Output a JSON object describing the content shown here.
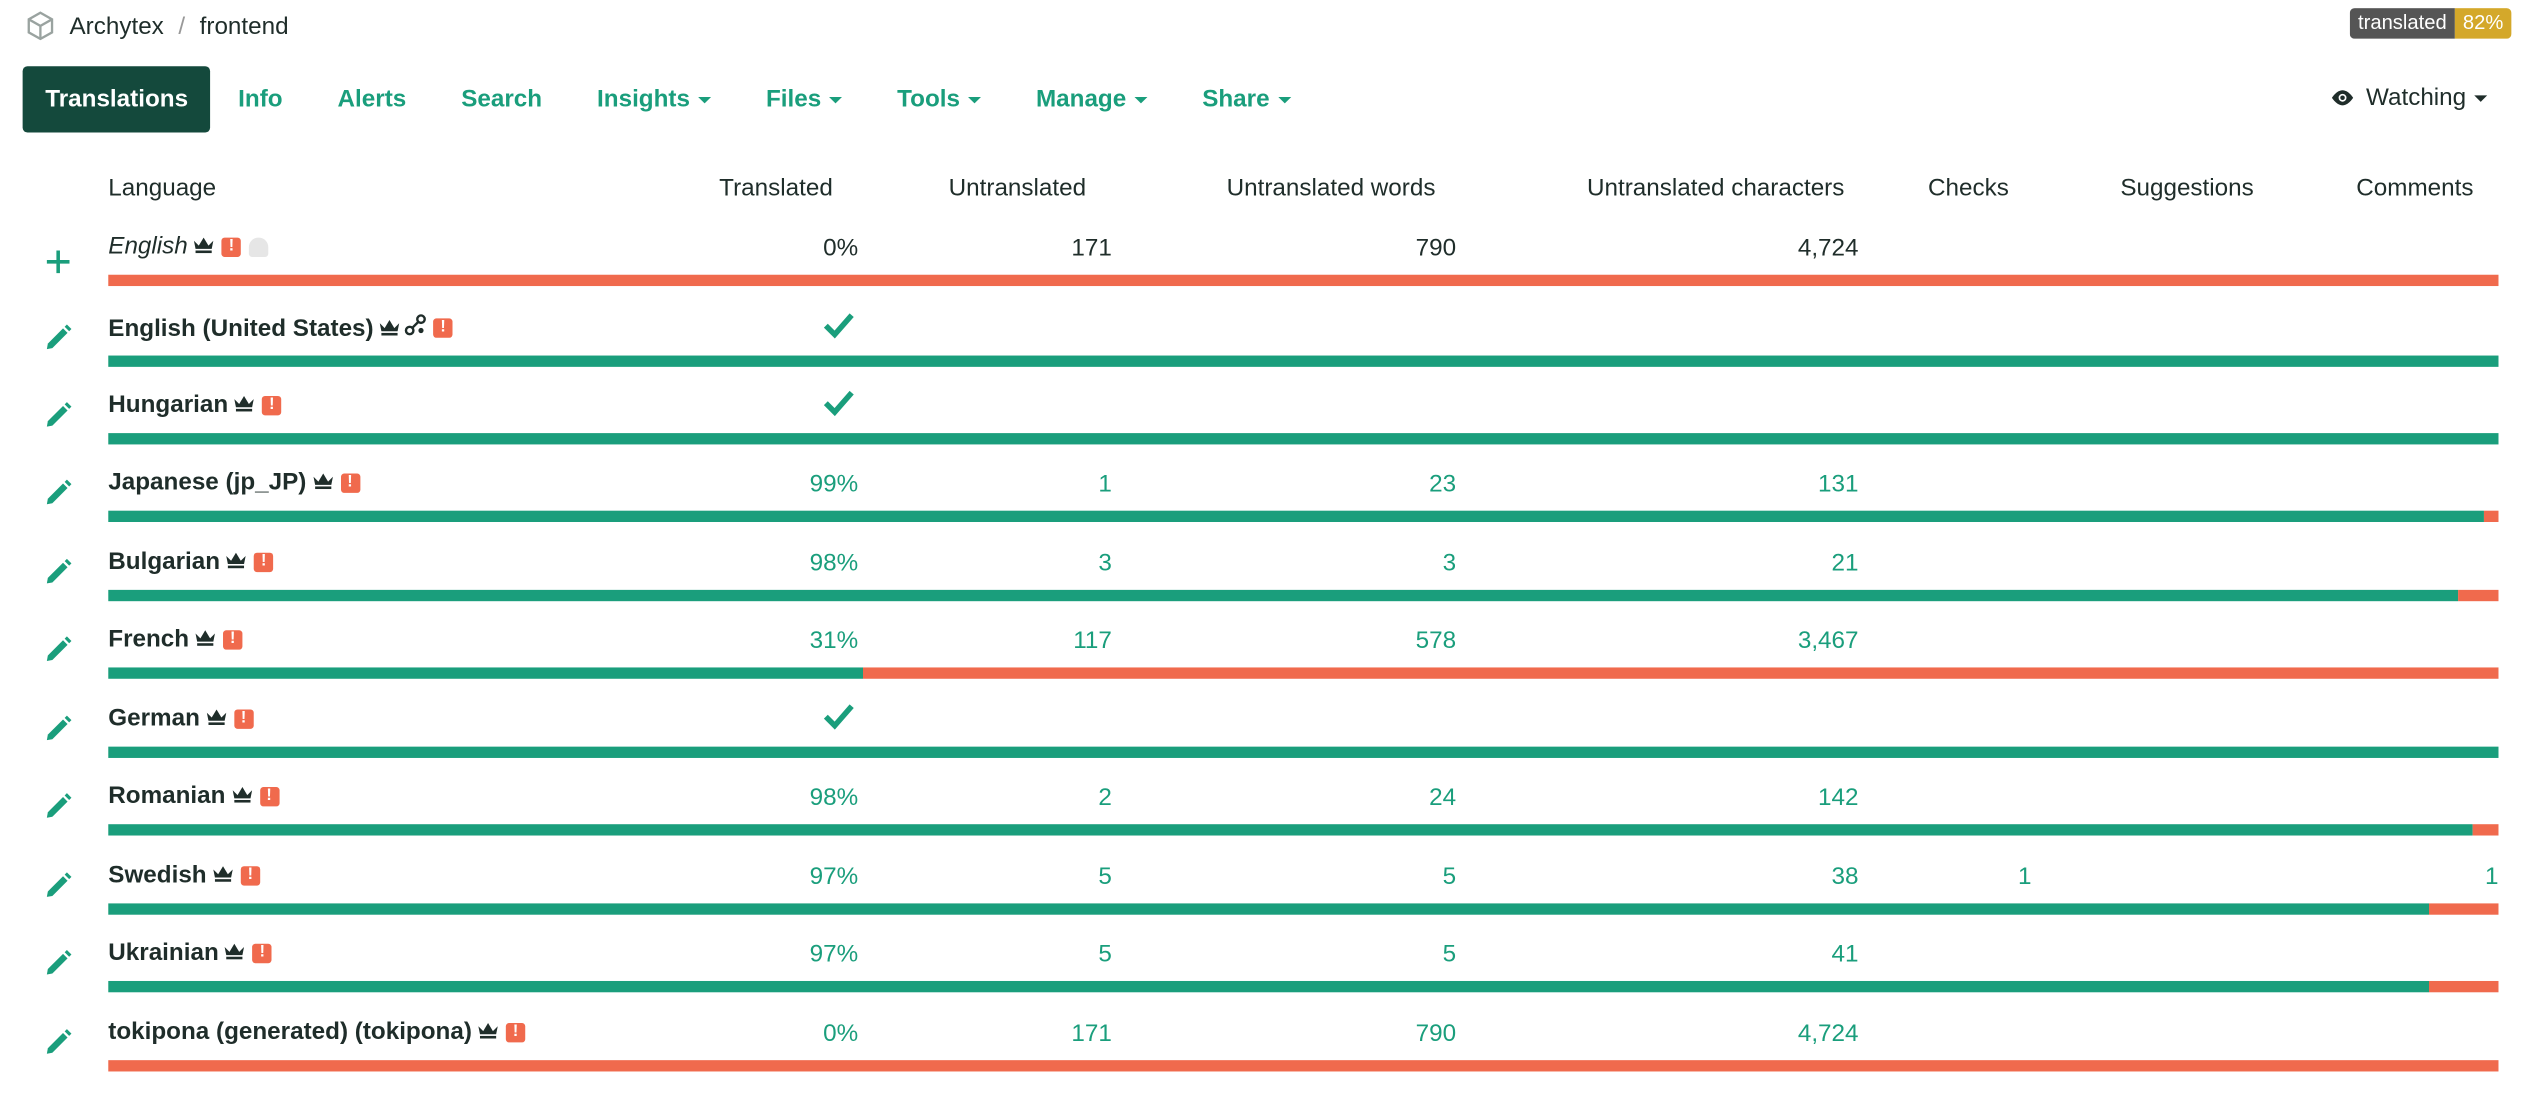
{
  "breadcrumb": {
    "project": "Archytex",
    "component": "frontend"
  },
  "badge": {
    "label": "translated",
    "value": "82%"
  },
  "nav": {
    "translations": "Translations",
    "info": "Info",
    "alerts": "Alerts",
    "search": "Search",
    "insights": "Insights",
    "files": "Files",
    "tools": "Tools",
    "manage": "Manage",
    "share": "Share",
    "watching": "Watching"
  },
  "headers": {
    "language": "Language",
    "translated": "Translated",
    "untranslated": "Untranslated",
    "untranslated_words": "Untranslated words",
    "untranslated_chars": "Untranslated characters",
    "checks": "Checks",
    "suggestions": "Suggestions",
    "comments": "Comments"
  },
  "rows": [
    {
      "name": "English",
      "source": true,
      "translated": "0%",
      "untranslated": "171",
      "words": "790",
      "chars": "4,724",
      "checks": "",
      "comments": "",
      "fill": 0.0,
      "complete": false
    },
    {
      "name": "English (United States)",
      "link": true,
      "translated": "",
      "untranslated": "",
      "words": "",
      "chars": "",
      "checks": "",
      "comments": "",
      "fill": 1.0,
      "complete": true
    },
    {
      "name": "Hungarian",
      "translated": "",
      "untranslated": "",
      "words": "",
      "chars": "",
      "checks": "",
      "comments": "",
      "fill": 1.0,
      "complete": true
    },
    {
      "name": "Japanese (jp_JP)",
      "translated": "99%",
      "untranslated": "1",
      "words": "23",
      "chars": "131",
      "checks": "",
      "comments": "",
      "fill": 0.994,
      "complete": false
    },
    {
      "name": "Bulgarian",
      "translated": "98%",
      "untranslated": "3",
      "words": "3",
      "chars": "21",
      "checks": "",
      "comments": "",
      "fill": 0.983,
      "complete": false
    },
    {
      "name": "French",
      "translated": "31%",
      "untranslated": "117",
      "words": "578",
      "chars": "3,467",
      "checks": "",
      "comments": "",
      "fill": 0.316,
      "complete": false
    },
    {
      "name": "German",
      "translated": "",
      "untranslated": "",
      "words": "",
      "chars": "",
      "checks": "",
      "comments": "",
      "fill": 1.0,
      "complete": true
    },
    {
      "name": "Romanian",
      "translated": "98%",
      "untranslated": "2",
      "words": "24",
      "chars": "142",
      "checks": "",
      "comments": "",
      "fill": 0.989,
      "complete": false
    },
    {
      "name": "Swedish",
      "translated": "97%",
      "untranslated": "5",
      "words": "5",
      "chars": "38",
      "checks": "1",
      "comments": "1",
      "fill": 0.971,
      "complete": false
    },
    {
      "name": "Ukrainian",
      "translated": "97%",
      "untranslated": "5",
      "words": "5",
      "chars": "41",
      "checks": "",
      "comments": "",
      "fill": 0.971,
      "complete": false
    },
    {
      "name": "tokipona (generated) (tokipona)",
      "translated": "0%",
      "untranslated": "171",
      "words": "790",
      "chars": "4,724",
      "checks": "",
      "comments": "",
      "fill": 0.0,
      "complete": false
    }
  ],
  "colors": {
    "accent": "#1a9e7c",
    "danger": "#f06a4d",
    "nav_active": "#14493c",
    "badge": "#d4a82a"
  },
  "icons": {
    "add": "plus-icon",
    "edit": "pencil-icon",
    "done": "check-icon",
    "watch": "eye-icon",
    "owner": "crown-icon",
    "alert": "alert-icon"
  }
}
